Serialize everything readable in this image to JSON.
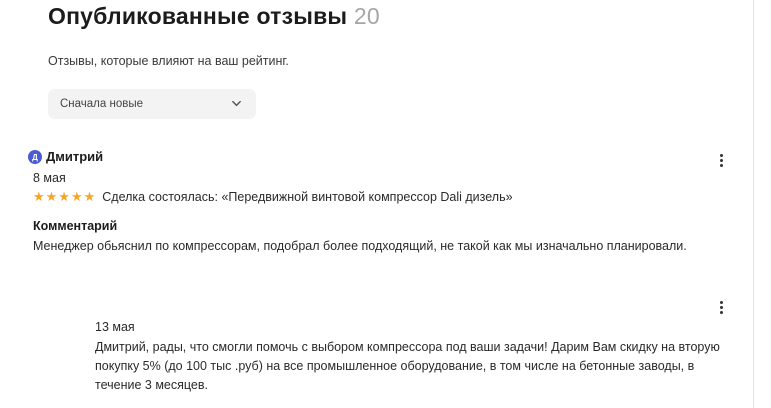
{
  "header": {
    "title": "Опубликованные отзывы",
    "count": "20",
    "subtitle": "Отзывы, которые влияют на ваш рейтинг."
  },
  "sort": {
    "selected": "Сначала новые",
    "icon": "chevron-down-icon"
  },
  "review": {
    "avatar_letter": "Д",
    "avatar_color": "#4a5bd4",
    "author": "Дмитрий",
    "date": "8 мая",
    "rating": 5,
    "stars": "★★★★★",
    "star_color": "#f4a62a",
    "deal": "Сделка состоялась: «Передвижной винтовой компрессор Dali дизель»",
    "comment_label": "Комментарий",
    "comment": "Менеджер обьяснил по компрессорам, подобрал более подходящий, не такой как мы изначально планировали."
  },
  "reply": {
    "date": "13 мая",
    "text": "Дмитрий, рады, что смогли помочь с выбором компрессора под ваши задачи! Дарим Вам скидку на вторую покупку 5% (до 100 тыс .руб) на все промышленное оборудование, в том числе на бетонные заводы, в течение 3 месяцев."
  }
}
